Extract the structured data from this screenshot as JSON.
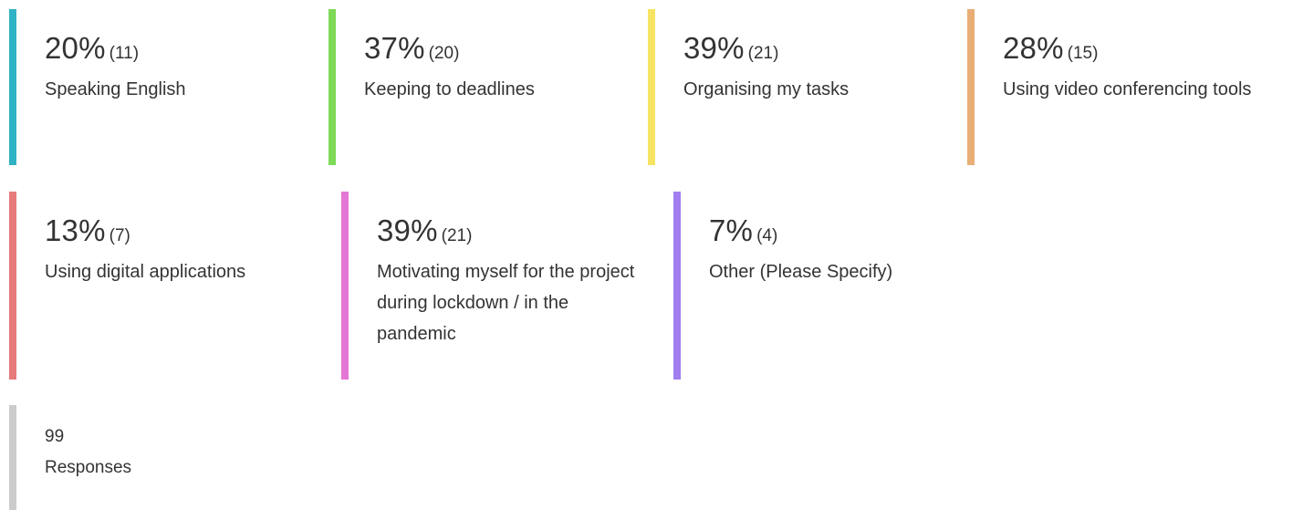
{
  "chart_data": {
    "type": "bar",
    "items": [
      {
        "percent": "20%",
        "count": "(11)",
        "label": "Speaking English",
        "color": "#2fb3c4",
        "value": 20
      },
      {
        "percent": "37%",
        "count": "(20)",
        "label": "Keeping to deadlines",
        "color": "#7ed957",
        "value": 37
      },
      {
        "percent": "39%",
        "count": "(21)",
        "label": "Organising my tasks",
        "color": "#f7e463",
        "value": 39
      },
      {
        "percent": "28%",
        "count": "(15)",
        "label": "Using video conferencing tools",
        "color": "#e9ad76",
        "value": 28
      },
      {
        "percent": "13%",
        "count": "(7)",
        "label": "Using digital applications",
        "color": "#e77a7a",
        "value": 13
      },
      {
        "percent": "39%",
        "count": "(21)",
        "label": "Motivating myself for the project during lockdown / in the pandemic",
        "color": "#e477d6",
        "value": 39
      },
      {
        "percent": "7%",
        "count": "(4)",
        "label": "Other (Please Specify)",
        "color": "#a07ef0",
        "value": 7
      }
    ],
    "total": {
      "number": "99",
      "label": "Responses",
      "color": "#cccccc"
    }
  }
}
